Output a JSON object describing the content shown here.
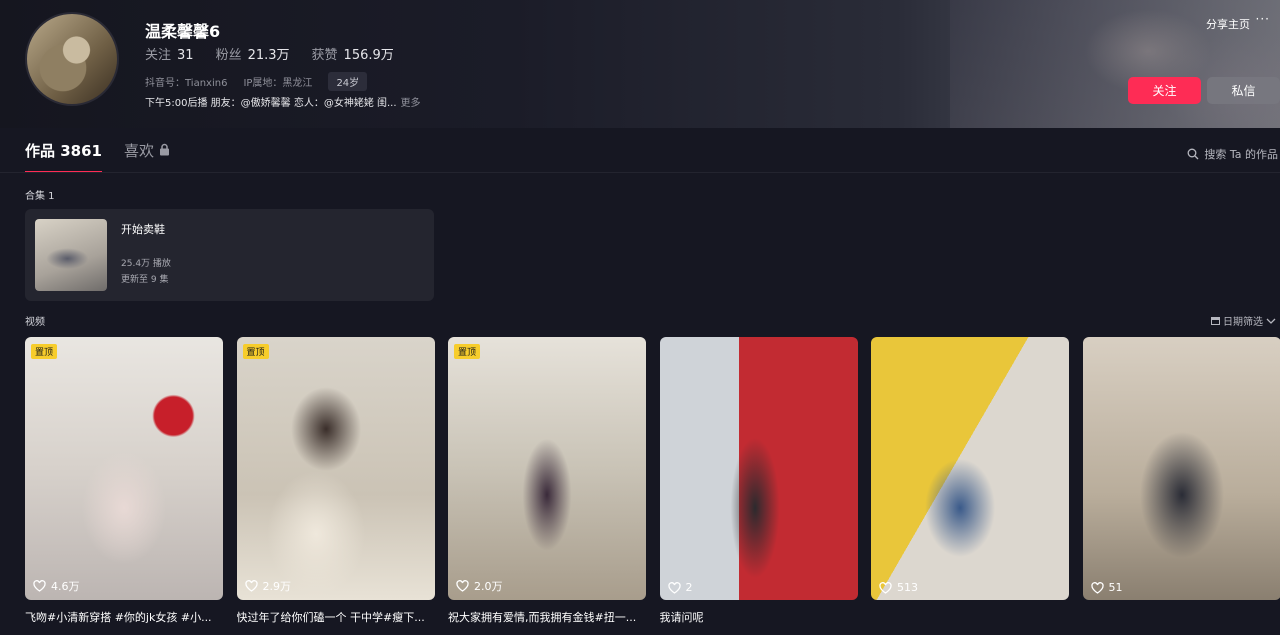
{
  "profile": {
    "name": "温柔馨馨6",
    "stats": [
      {
        "label": "关注",
        "value": "31"
      },
      {
        "label": "粉丝",
        "value": "21.3万"
      },
      {
        "label": "获赞",
        "value": "156.9万"
      }
    ],
    "douyin_id": "抖音号：Tianxin6",
    "ip_location": "IP属地：黑龙江",
    "age": "24岁",
    "bio": "下午5:00后播 朋友：@傲娇馨馨 恋人：@女神姥姥 闺...",
    "bio_more": "更多"
  },
  "header_actions": {
    "share": "分享主页",
    "more": "···",
    "follow": "关注",
    "message": "私信"
  },
  "tabs": {
    "works_label": "作品",
    "works_count": "3861",
    "likes_label": "喜欢"
  },
  "search": {
    "label": "搜索 Ta 的作品"
  },
  "collections": {
    "heading": "合集 1",
    "items": [
      {
        "title": "开始卖鞋",
        "plays": "25.4万 播放",
        "update": "更新至 9 集"
      }
    ]
  },
  "videos": {
    "heading": "视频",
    "filter": "日期筛选",
    "items": [
      {
        "pinned": "置顶",
        "likes": "4.6万",
        "caption": "飞吻#小清新穿搭 #你的jk女孩 #小..."
      },
      {
        "pinned": "置顶",
        "likes": "2.9万",
        "caption": "快过年了给你们磕一个 干中学#瘦下..."
      },
      {
        "pinned": "置顶",
        "likes": "2.0万",
        "caption": "祝大家拥有爱情,而我拥有金钱#扭一..."
      },
      {
        "pinned": "",
        "likes": "2",
        "caption": "我请问呢"
      },
      {
        "pinned": "",
        "likes": "513",
        "caption": ""
      },
      {
        "pinned": "",
        "likes": "51",
        "caption": ""
      }
    ]
  },
  "colors": {
    "accent": "#fe2c55",
    "pin_badge": "#f7cd2c",
    "background": "#161722"
  }
}
